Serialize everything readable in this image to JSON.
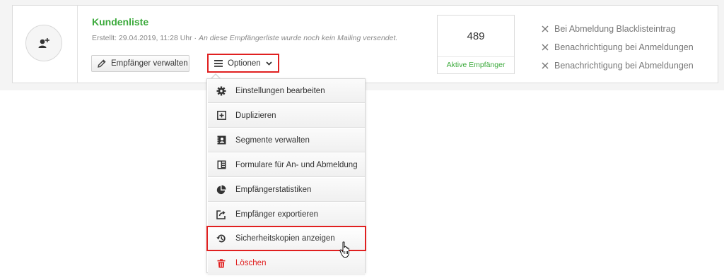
{
  "list": {
    "title": "Kundenliste",
    "created": "Erstellt: 29.04.2019, 11:28 Uhr · ",
    "note": "An diese Empfängerliste wurde noch kein Mailing versendet."
  },
  "buttons": {
    "manage_label": "Empfänger verwalten",
    "options_label": "Optionen"
  },
  "stats": {
    "count": "489",
    "label": "Aktive Empfänger"
  },
  "flags": [
    "Bei Abmeldung Blacklisteintrag",
    "Benachrichtigung bei Anmeldungen",
    "Benachrichtigung bei Abmeldungen"
  ],
  "menu": [
    {
      "label": "Einstellungen bearbeiten",
      "icon": "gear-icon"
    },
    {
      "label": "Duplizieren",
      "icon": "duplicate-icon"
    },
    {
      "label": "Segmente verwalten",
      "icon": "segments-icon"
    },
    {
      "label": "Formulare für An- und Abmeldung",
      "icon": "form-icon"
    },
    {
      "label": "Empfängerstatistiken",
      "icon": "pie-chart-icon"
    },
    {
      "label": "Empfänger exportieren",
      "icon": "export-icon"
    },
    {
      "label": "Sicherheitskopien anzeigen",
      "icon": "history-icon"
    },
    {
      "label": "Löschen",
      "icon": "trash-icon"
    }
  ],
  "colors": {
    "accent_green": "#3caa3c",
    "highlight_red": "#e02020"
  }
}
